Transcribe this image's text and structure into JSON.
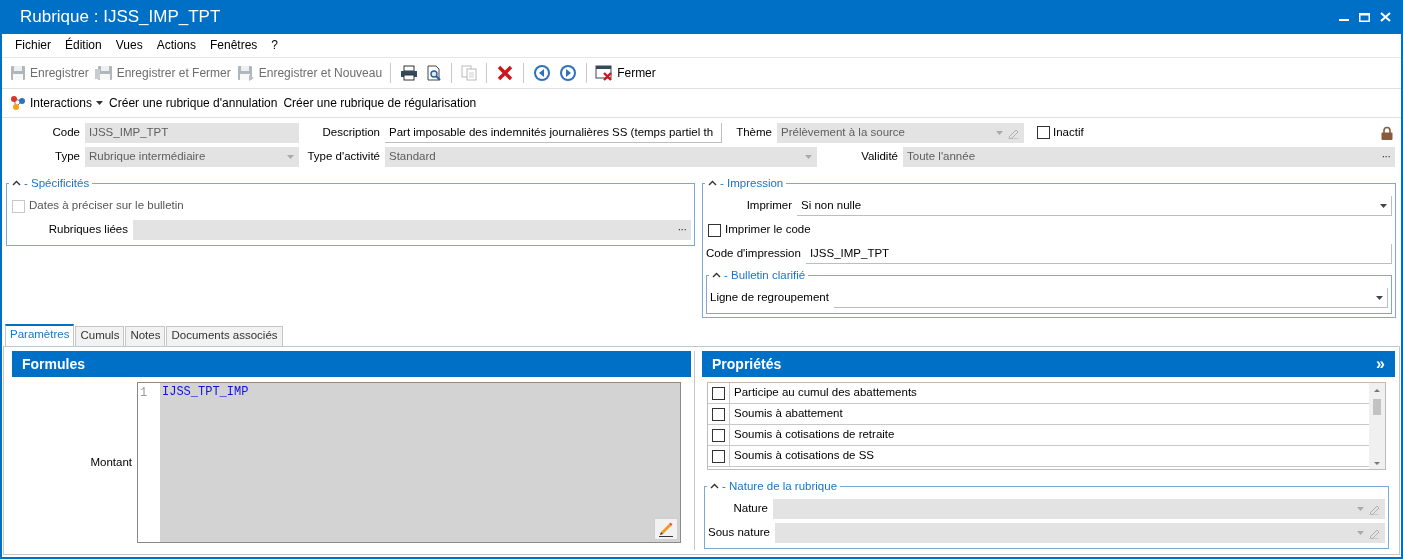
{
  "window": {
    "title": "Rubrique : IJSS_IMP_TPT"
  },
  "menu": [
    {
      "label": "Fichier"
    },
    {
      "label": "Édition"
    },
    {
      "label": "Vues"
    },
    {
      "label": "Actions"
    },
    {
      "label": "Fenêtres"
    },
    {
      "label": "?"
    }
  ],
  "toolbar": [
    {
      "kind": "button",
      "label": "Enregistrer",
      "disabled": true
    },
    {
      "kind": "button",
      "label": "Enregistrer et Fermer",
      "disabled": true
    },
    {
      "kind": "button",
      "label": "Enregistrer et Nouveau",
      "disabled": true
    },
    {
      "kind": "separator"
    },
    {
      "kind": "icon",
      "disabled": false
    },
    {
      "kind": "icon",
      "disabled": false
    },
    {
      "kind": "separator"
    },
    {
      "kind": "icon",
      "disabled": true
    },
    {
      "kind": "separator"
    },
    {
      "kind": "icon",
      "disabled": false
    },
    {
      "kind": "separator"
    },
    {
      "kind": "icon",
      "disabled": false
    },
    {
      "kind": "icon",
      "disabled": false
    },
    {
      "kind": "separator"
    },
    {
      "kind": "button",
      "label": "Fermer",
      "disabled": false
    }
  ],
  "actions": [
    {
      "kind": "dropdown",
      "label": "Interactions"
    },
    {
      "kind": "link",
      "label": "Créer une rubrique d'annulation"
    },
    {
      "kind": "link",
      "label": "Créer une rubrique de régularisation"
    }
  ],
  "header": {
    "code": {
      "label": "Code",
      "kind": "text",
      "value": "IJSS_IMP_TPT",
      "disabled": true
    },
    "description": {
      "label": "Description",
      "kind": "text",
      "value": "Part imposable des indemnités journalières SS (temps partiel th",
      "disabled": false
    },
    "theme": {
      "label": "Thème",
      "kind": "combo-edit",
      "value": "Prélèvement à la source",
      "disabled": true
    },
    "inactif": {
      "label": "Inactif",
      "checked": false,
      "disabled": false
    },
    "locked": true,
    "type": {
      "label": "Type",
      "kind": "combo",
      "value": "Rubrique intermédiaire",
      "disabled": true
    },
    "type_activite": {
      "label": "Type d'activité",
      "kind": "combo",
      "value": "Standard",
      "disabled": true
    },
    "validite": {
      "label": "Validité",
      "kind": "picker",
      "value": "Toute l'année",
      "button": "···",
      "disabled": true
    }
  },
  "specificites": {
    "title": "- Spécificités",
    "expanded": true,
    "rows": [
      {
        "kind": "checkbox",
        "label": "Dates à préciser sur le bulletin",
        "checked": false,
        "disabled": true
      },
      {
        "kind": "picker",
        "label": "Rubriques liées",
        "button": "···",
        "disabled": true
      }
    ]
  },
  "impression": {
    "title": "- Impression",
    "expanded": true,
    "rows": [
      {
        "kind": "combo",
        "label": "Imprimer",
        "value": "Si non nulle",
        "disabled": false
      },
      {
        "kind": "checkbox",
        "label": "Imprimer le code",
        "checked": false,
        "disabled": false
      },
      {
        "kind": "text",
        "label": "Code d'impression",
        "value": "IJSS_IMP_TPT",
        "disabled": false
      },
      {
        "kind": "group",
        "title": "- Bulletin clarifié",
        "expanded": true,
        "rows": [
          {
            "kind": "combo",
            "label": "Ligne de regroupement",
            "disabled": false
          }
        ]
      }
    ]
  },
  "tabs": [
    {
      "label": "Paramètres",
      "selected": true
    },
    {
      "label": "Cumuls",
      "selected": false
    },
    {
      "label": "Notes",
      "selected": false
    },
    {
      "label": "Documents associés",
      "selected": false
    }
  ],
  "formules": {
    "title": "Formules",
    "editor": {
      "label": "Montant",
      "lines": [
        {
          "number": "1",
          "code": "IJSS_TPT_IMP"
        }
      ]
    }
  },
  "proprietes": {
    "title": "Propriétés",
    "expand": "»",
    "items": [
      {
        "label": "Participe au cumul des abattements",
        "checked": false
      },
      {
        "label": "Soumis à abattement",
        "checked": false
      },
      {
        "label": "Soumis à cotisations de retraite",
        "checked": false
      },
      {
        "label": "Soumis à cotisations de SS",
        "checked": false
      }
    ],
    "nature": {
      "title": "- Nature de la rubrique",
      "expanded": true,
      "rows": [
        {
          "kind": "combo-edit",
          "label": "Nature",
          "disabled": true
        },
        {
          "kind": "combo-edit",
          "label": "Sous nature",
          "disabled": true
        }
      ]
    }
  }
}
